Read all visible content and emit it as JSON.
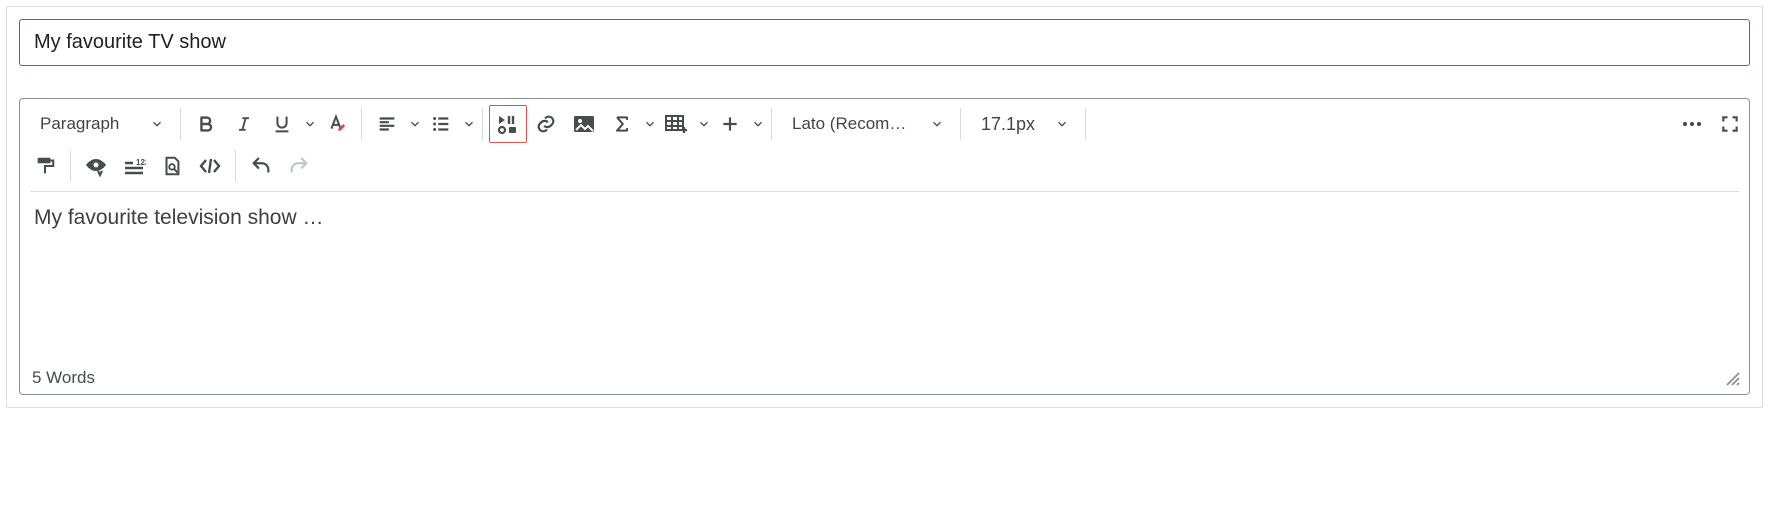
{
  "title_input": {
    "value": "My favourite TV show"
  },
  "toolbar": {
    "paragraph_label": "Paragraph",
    "font_label": "Lato (Recomm…",
    "size_label": "17.1px"
  },
  "editor": {
    "content": "My favourite television show …"
  },
  "status": {
    "wordcount": "5 Words"
  }
}
